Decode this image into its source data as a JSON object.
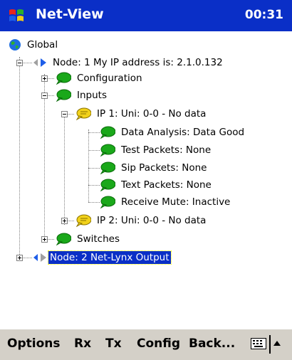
{
  "titlebar": {
    "app_name": "Net-View",
    "time": "00:31"
  },
  "tree": {
    "global_label": "Global",
    "node1_label": "Node: 1 My IP address is: 2.1.0.132",
    "configuration_label": "Configuration",
    "inputs_label": "Inputs",
    "ip1_label": "IP 1: Uni: 0-0 - No data",
    "data_analysis_label": "Data Analysis: Data Good",
    "test_packets_label": "Test Packets: None",
    "sip_packets_label": "Sip Packets: None",
    "text_packets_label": "Text Packets: None",
    "receive_mute_label": "Receive Mute: Inactive",
    "ip2_label": "IP 2: Uni: 0-0 - No data",
    "switches_label": "Switches",
    "node2_label": "Node: 2 Net-Lynx Output"
  },
  "menubar": {
    "options": "Options",
    "rx": "Rx",
    "tx": "Tx",
    "config": "Config",
    "back": "Back..."
  },
  "colors": {
    "titlebar": "#0a2fc7",
    "bubble_green": "#1aa81a",
    "bubble_yellow": "#f2d21a",
    "selection": "#0a2fc7"
  },
  "icons": [
    "windows-flag-icon",
    "globe-icon",
    "node-arrows-icon",
    "green-bubble-icon",
    "yellow-bubble-icon",
    "keyboard-icon",
    "up-arrow-icon"
  ]
}
